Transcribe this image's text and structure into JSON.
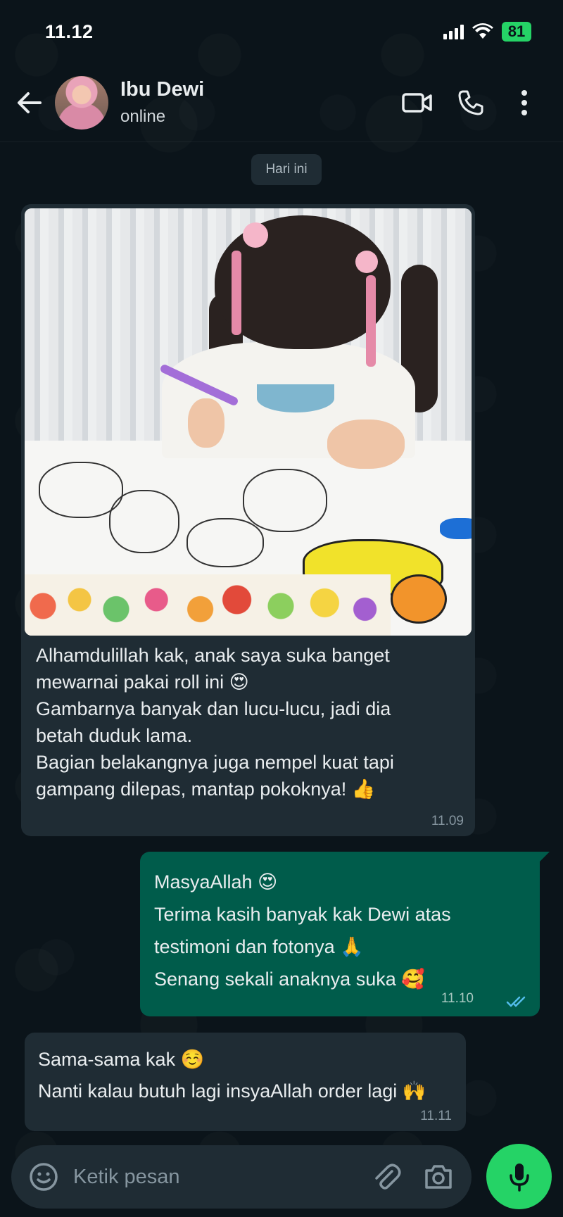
{
  "status_bar": {
    "time": "11.12",
    "battery": "81"
  },
  "header": {
    "contact_name": "Ibu Dewi",
    "contact_status": "online"
  },
  "chat": {
    "date_chip": "Hari ini",
    "messages": [
      {
        "direction": "incoming",
        "has_photo": true,
        "text": "Alhamdulillah kak, anak saya suka banget\nmewarnai pakai roll ini 😍\nGambarnya banyak dan lucu-lucu, jadi dia\nbetah duduk lama.\nBagian belakangnya juga nempel kuat tapi\ngampang dilepas, mantap pokoknya! 👍",
        "time": "11.09"
      },
      {
        "direction": "outgoing",
        "text": "MasyaAllah 😍\nTerima kasih banyak kak Dewi atas\ntestimoni dan fotonya 🙏\nSenang sekali anaknya suka 🥰",
        "time": "11.10",
        "read": true
      },
      {
        "direction": "incoming",
        "text": "Sama-sama kak ☺️\nNanti kalau butuh lagi insyaAllah order lagi 🙌",
        "time": "11.11"
      }
    ]
  },
  "composer": {
    "placeholder": "Ketik pesan"
  },
  "icons": {
    "back": "arrow-left-icon",
    "video": "video-call-icon",
    "phone": "phone-icon",
    "menu": "more-vert-icon",
    "emoji": "emoji-icon",
    "attach": "paperclip-icon",
    "camera": "camera-icon",
    "mic": "mic-icon"
  },
  "colors": {
    "background": "#0b141a",
    "incoming_bubble": "#1f2c34",
    "outgoing_bubble": "#005c4b",
    "accent": "#25d366",
    "read_ticks": "#53bdeb"
  }
}
